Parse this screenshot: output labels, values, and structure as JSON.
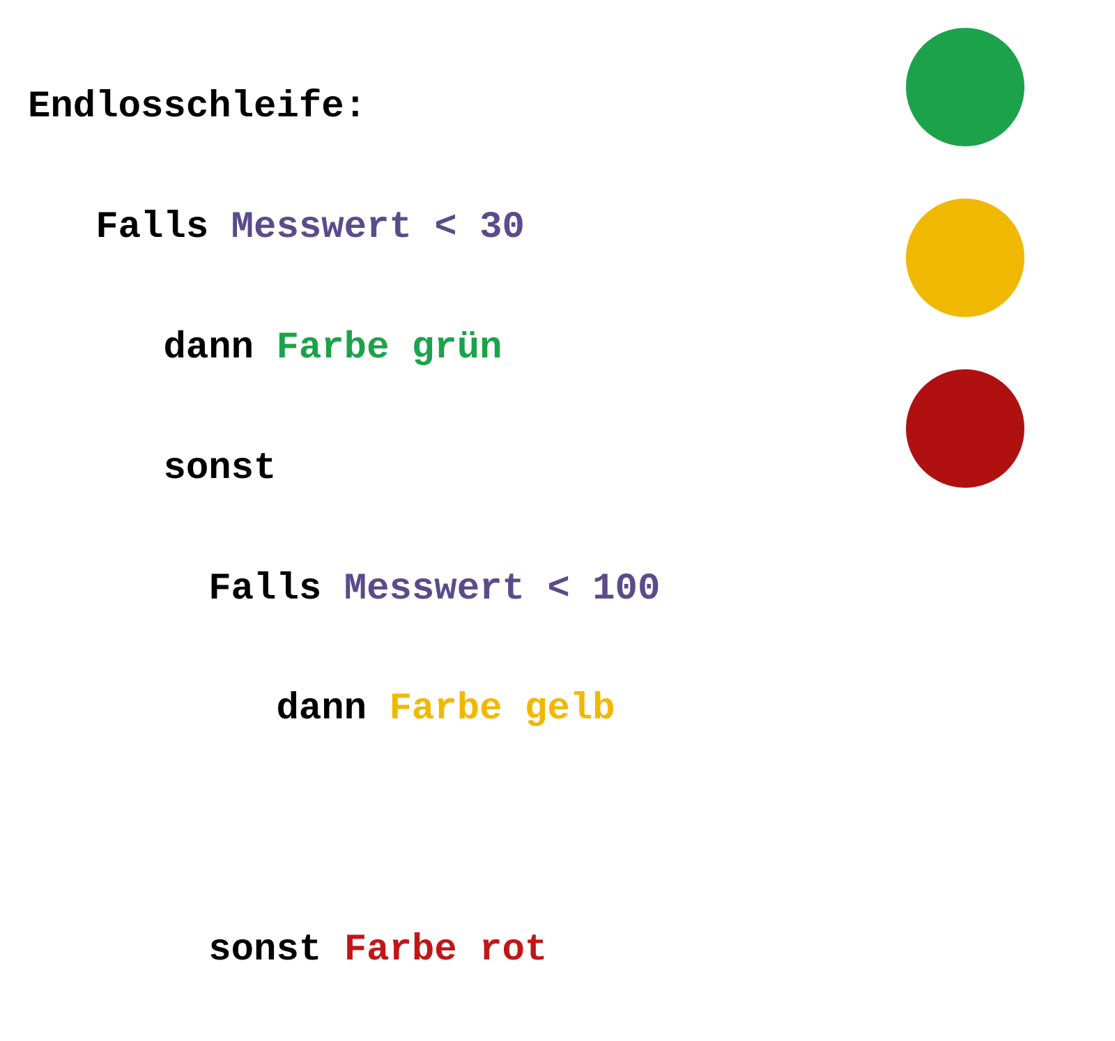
{
  "code": {
    "l1_loop": "Endlosschleife:",
    "l2_falls": "Falls ",
    "l2_cond": "Messwert < 30",
    "l3_dann": "dann ",
    "l3_action": "Farbe grün",
    "l4_sonst": "sonst",
    "l5_falls": "Falls ",
    "l5_cond": "Messwert < 100",
    "l6_dann": "dann ",
    "l6_action": "Farbe gelb",
    "l8_sonst": "sonst ",
    "l8_action": "Farbe rot"
  },
  "colors": {
    "black": "#000000",
    "purple": "#5b4b8a",
    "green": "#1ca24a",
    "yellow": "#f0b800",
    "red": "#c21616"
  },
  "indicators": [
    "green",
    "yellow",
    "red"
  ]
}
